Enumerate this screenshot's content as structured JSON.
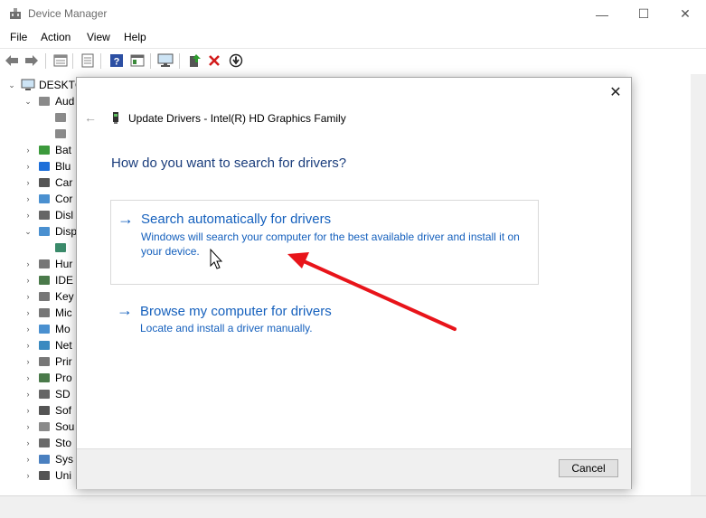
{
  "window": {
    "title": "Device Manager",
    "minimize_glyph": "—",
    "maximize_glyph": "☐",
    "close_glyph": "✕"
  },
  "menu": [
    "File",
    "Action",
    "View",
    "Help"
  ],
  "toolbar_icons": [
    "back-icon",
    "forward-icon",
    "properties-icon",
    "show-hidden-icon",
    "help-icon",
    "view-icon",
    "monitor-icon",
    "update-driver-icon",
    "uninstall-icon",
    "scan-icon"
  ],
  "tree": {
    "root": "DESKTC",
    "items": [
      {
        "label": "Aud",
        "chev": "⌄",
        "icon": "audio-icon",
        "level": 1
      },
      {
        "label": "",
        "chev": "",
        "icon": "mic-icon",
        "level": 2
      },
      {
        "label": "",
        "chev": "",
        "icon": "speaker-icon",
        "level": 2
      },
      {
        "label": "Bat",
        "chev": "›",
        "icon": "battery-icon",
        "level": 1
      },
      {
        "label": "Blu",
        "chev": "›",
        "icon": "bluetooth-icon",
        "level": 1
      },
      {
        "label": "Car",
        "chev": "›",
        "icon": "camera-icon",
        "level": 1
      },
      {
        "label": "Cor",
        "chev": "›",
        "icon": "computer-icon",
        "level": 1
      },
      {
        "label": "Disl",
        "chev": "›",
        "icon": "disk-icon",
        "level": 1
      },
      {
        "label": "Disp",
        "chev": "⌄",
        "icon": "display-icon",
        "level": 1
      },
      {
        "label": "",
        "chev": "",
        "icon": "display-adapter-icon",
        "level": 2
      },
      {
        "label": "Hur",
        "chev": "›",
        "icon": "hid-icon",
        "level": 1
      },
      {
        "label": "IDE",
        "chev": "›",
        "icon": "ide-icon",
        "level": 1
      },
      {
        "label": "Key",
        "chev": "›",
        "icon": "keyboard-icon",
        "level": 1
      },
      {
        "label": "Mic",
        "chev": "›",
        "icon": "mouse-icon",
        "level": 1
      },
      {
        "label": "Mo",
        "chev": "›",
        "icon": "monitor-icon",
        "level": 1
      },
      {
        "label": "Net",
        "chev": "›",
        "icon": "network-icon",
        "level": 1
      },
      {
        "label": "Prir",
        "chev": "›",
        "icon": "printer-icon",
        "level": 1
      },
      {
        "label": "Pro",
        "chev": "›",
        "icon": "processor-icon",
        "level": 1
      },
      {
        "label": "SD",
        "chev": "›",
        "icon": "sd-icon",
        "level": 1
      },
      {
        "label": "Sof",
        "chev": "›",
        "icon": "software-icon",
        "level": 1
      },
      {
        "label": "Sou",
        "chev": "›",
        "icon": "sound-icon",
        "level": 1
      },
      {
        "label": "Sto",
        "chev": "›",
        "icon": "storage-icon",
        "level": 1
      },
      {
        "label": "Sys",
        "chev": "›",
        "icon": "system-icon",
        "level": 1
      },
      {
        "label": "Uni",
        "chev": "›",
        "icon": "usb-icon",
        "level": 1
      }
    ]
  },
  "dialog": {
    "close_glyph": "✕",
    "back_glyph": "←",
    "header": "Update Drivers - Intel(R) HD Graphics Family",
    "question": "How do you want to search for drivers?",
    "option_arrow": "→",
    "options": [
      {
        "title": "Search automatically for drivers",
        "description": "Windows will search your computer for the best available driver and install it on your device."
      },
      {
        "title": "Browse my computer for drivers",
        "description": "Locate and install a driver manually."
      }
    ],
    "cancel_label": "Cancel"
  },
  "colors": {
    "link_blue": "#1560bd",
    "question_blue": "#1a3d7c",
    "annotation_red": "#e8141a"
  }
}
